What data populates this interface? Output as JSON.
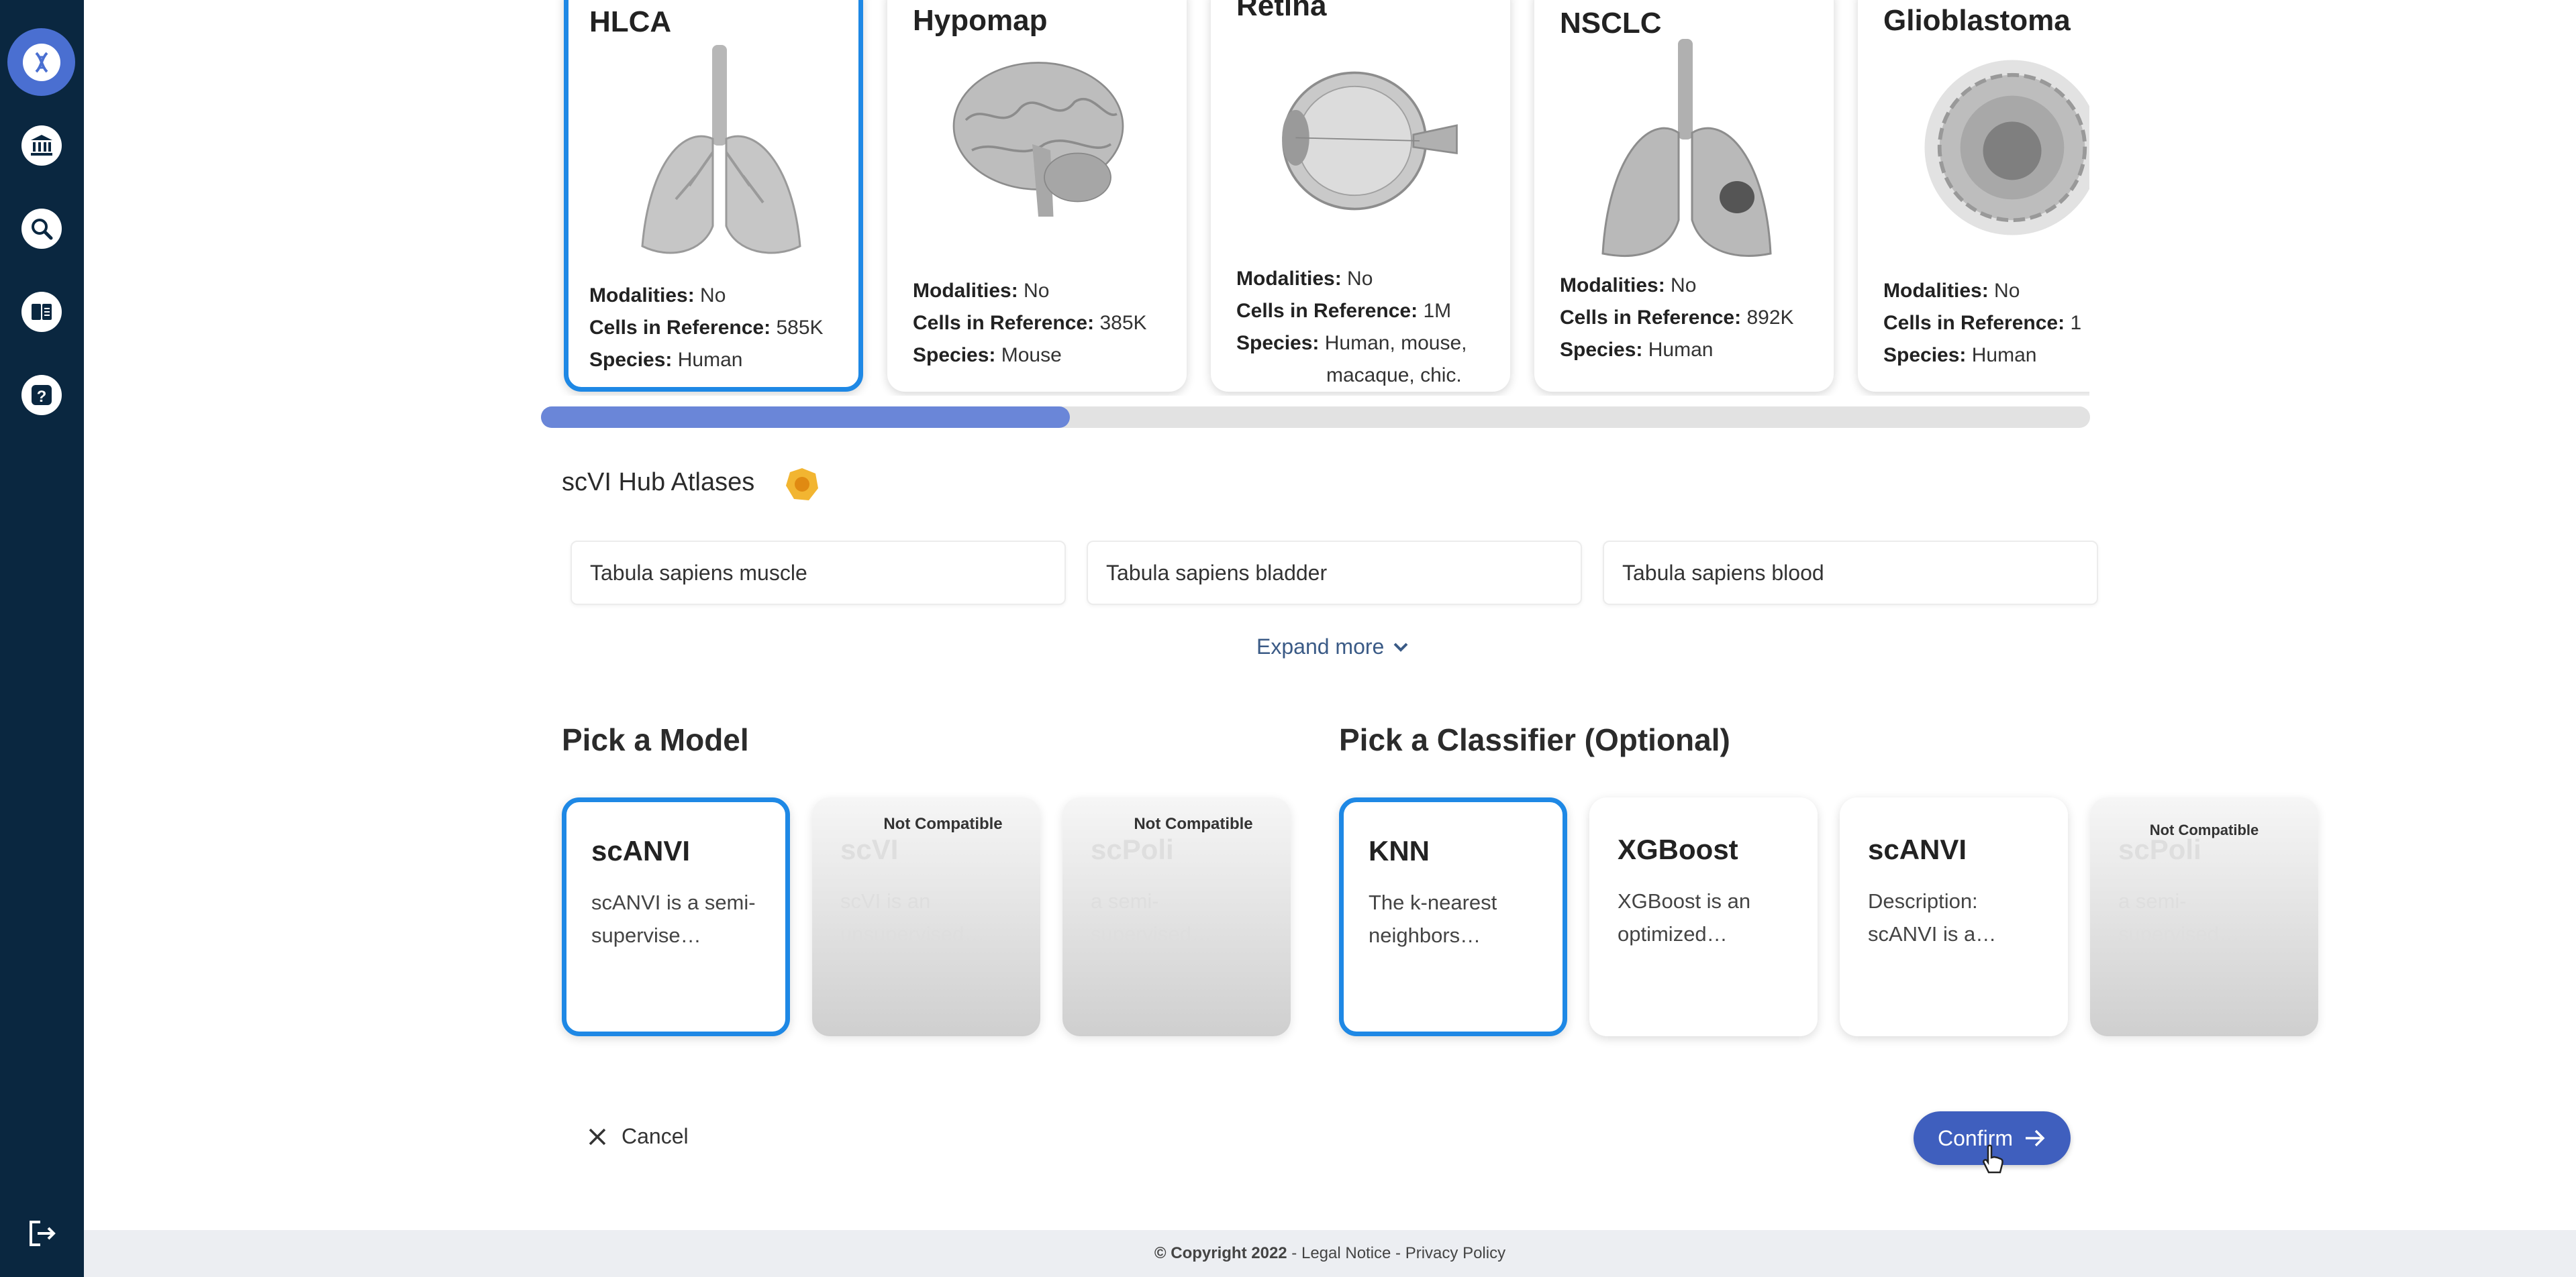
{
  "sidebar": {
    "items": [
      {
        "icon": "dna-icon"
      },
      {
        "icon": "bank-icon"
      },
      {
        "icon": "search-icon"
      },
      {
        "icon": "book-icon"
      },
      {
        "icon": "help-icon"
      }
    ],
    "logout_icon": "logout-icon"
  },
  "atlases": [
    {
      "name": "HLCA",
      "modalities": "No",
      "cells": "585K",
      "species": "Human",
      "selected": true
    },
    {
      "name": "Hypomap",
      "modalities": "No",
      "cells": "385K",
      "species": "Mouse"
    },
    {
      "name": "Retina",
      "modalities": "No",
      "cells": "1M",
      "species": "Human, mouse,",
      "species2": "macaque, chic."
    },
    {
      "name": "NSCLC",
      "modalities": "No",
      "cells": "892K",
      "species": "Human"
    },
    {
      "name": "Glioblastoma",
      "modalities": "No",
      "cells": "1",
      "species": "Human"
    }
  ],
  "labels": {
    "modalities": "Modalities:",
    "cells": "Cells in Reference:",
    "species": "Species:"
  },
  "hub": {
    "title": "scVI Hub Atlases",
    "items": [
      "Tabula sapiens muscle",
      "Tabula sapiens bladder",
      "Tabula sapiens blood"
    ],
    "expand_label": "Expand more"
  },
  "models": {
    "title": "Pick a Model",
    "items": [
      {
        "name": "scANVI",
        "desc": "scANVI is a semi-supervise…",
        "status": "selected"
      },
      {
        "name": "scVI",
        "desc": "scVI is an unsupervised…",
        "status": "disabled",
        "badge": "Not Compatible"
      },
      {
        "name": "scPoli",
        "desc": "a semi-supervised…",
        "status": "disabled",
        "badge": "Not Compatible"
      }
    ]
  },
  "classifiers": {
    "title": "Pick a Classifier (Optional)",
    "items": [
      {
        "name": "KNN",
        "desc": "The k-nearest neighbors…",
        "status": "selected"
      },
      {
        "name": "XGBoost",
        "desc": "XGBoost is an optimized…",
        "status": "normal"
      },
      {
        "name": "scANVI",
        "desc": "Description: scANVI is a…",
        "status": "normal"
      },
      {
        "name": "scPoli",
        "desc": "a semi-supervised…",
        "status": "disabled",
        "badge": "Not Compatible"
      }
    ]
  },
  "actions": {
    "cancel": "Cancel",
    "confirm": "Confirm"
  },
  "footer": {
    "copyright": "© Copyright 2022",
    "sep1": " - ",
    "legal": "Legal Notice",
    "sep2": " - ",
    "privacy": "Privacy Policy"
  },
  "colors": {
    "sidebar": "#0a2740",
    "accent": "#1e88e5",
    "confirm": "#3f5fbe",
    "scroll_thumb": "#6a86d8"
  }
}
